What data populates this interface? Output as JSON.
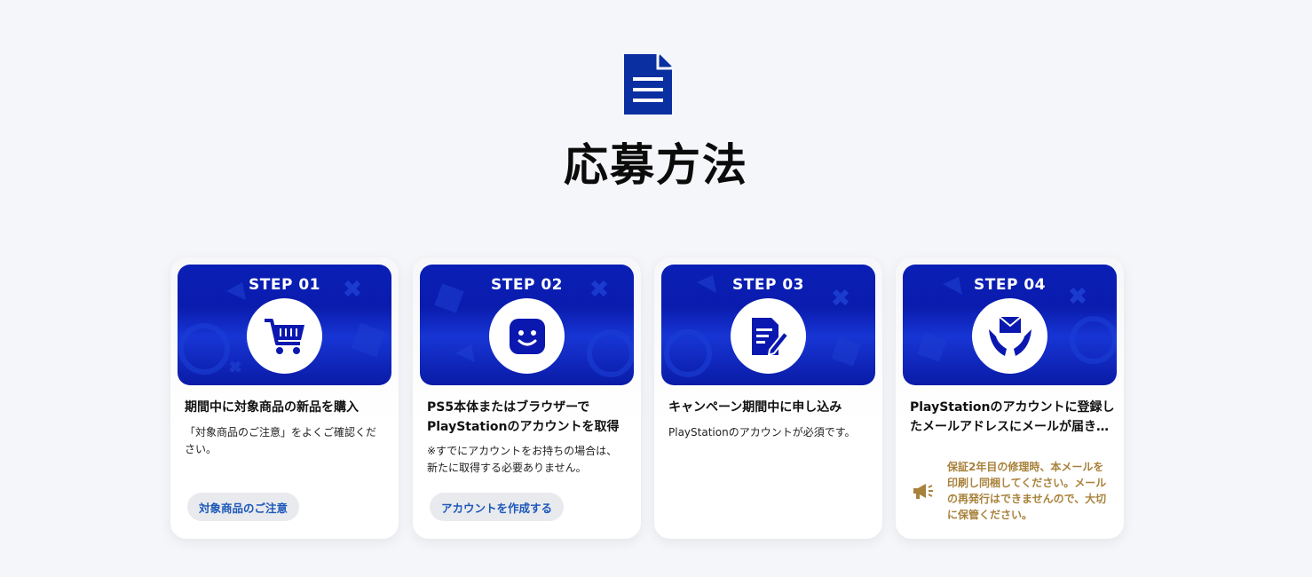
{
  "section": {
    "icon": "document-icon",
    "title": "応募方法"
  },
  "colors": {
    "accent": "#0a2fa0",
    "banner": "#0a1fb5",
    "link": "#1c58b8",
    "notice": "#a8823b"
  },
  "steps": [
    {
      "label": "STEP 01",
      "icon": "shopping-cart-icon",
      "title": "期間中に対象商品の新品を購入",
      "description": "「対象商品のご注意」をよくご確認ください。",
      "button": "対象商品のご注意"
    },
    {
      "label": "STEP 02",
      "icon": "smiley-face-icon",
      "title": "PS5本体またはブラウザーでPlayStationのアカウントを取得",
      "description": "※すでにアカウントをお持ちの場合は、新たに取得する必要ありません。",
      "button": "アカウントを作成する"
    },
    {
      "label": "STEP 03",
      "icon": "form-edit-icon",
      "title": "キャンペーン期間中に申し込み",
      "description": "PlayStationのアカウントが必須です。"
    },
    {
      "label": "STEP 04",
      "icon": "mail-hands-icon",
      "title": "PlayStationのアカウントに登録したメールアドレスにメールが届き…",
      "notice_icon": "megaphone-icon",
      "notice": "保証2年目の修理時、本メールを印刷し同梱してください。メールの再発行はできませんので、大切に保管ください。"
    }
  ]
}
